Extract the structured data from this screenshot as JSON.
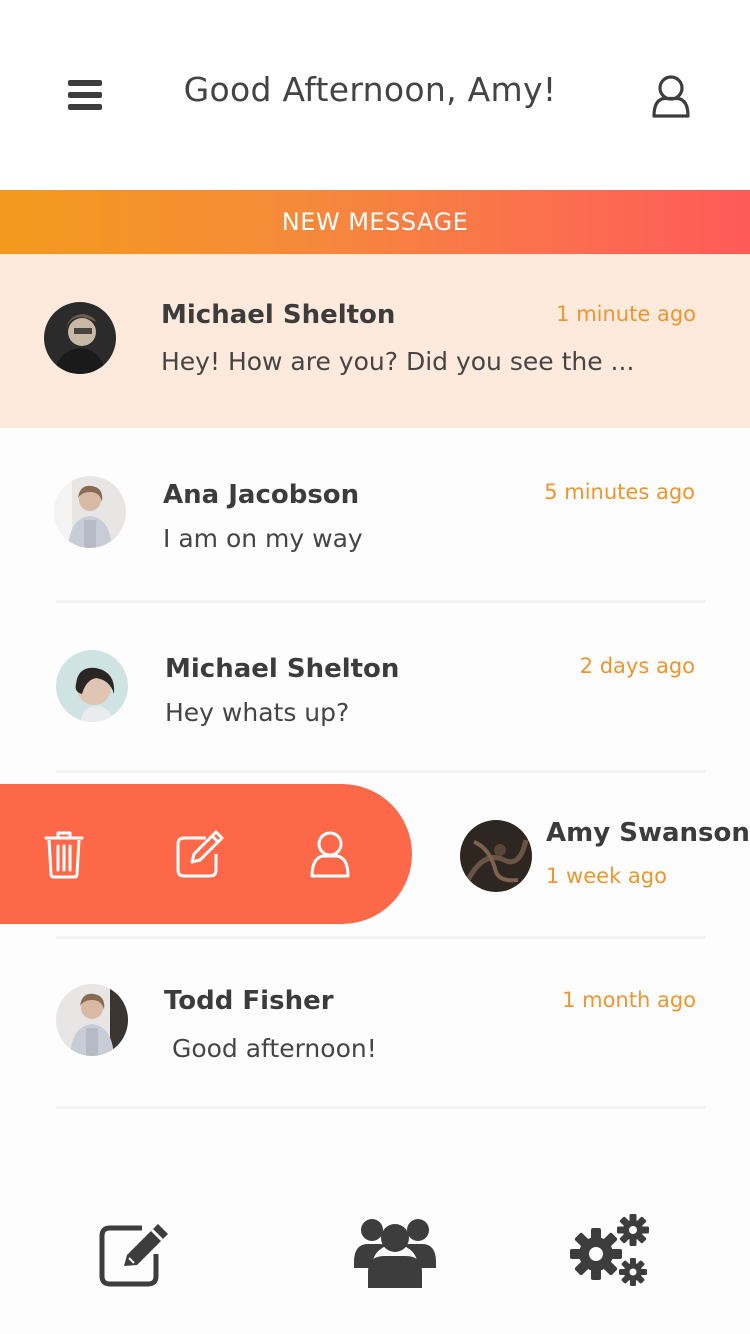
{
  "header": {
    "greeting": "Good Afternoon, Amy!",
    "menu_icon": "hamburger-menu-icon",
    "profile_icon": "user-icon"
  },
  "new_message": {
    "label": "NEW MESSAGE"
  },
  "conversations": [
    {
      "name": "Michael Shelton",
      "time": "1 minute ago",
      "message": "Hey! How are you? Did you see the ...",
      "highlighted": true
    },
    {
      "name": "Ana Jacobson",
      "time": "5 minutes ago",
      "message": "I am on my way"
    },
    {
      "name": "Michael Shelton",
      "time": "2 days ago",
      "message": "Hey whats up?"
    },
    {
      "name": "Amy Swanson",
      "time": "1 week ago",
      "message": ""
    },
    {
      "name": "Todd Fisher",
      "time": "1 month ago",
      "message": " Good afternoon!"
    }
  ],
  "swipe_actions": [
    {
      "icon": "trash-icon"
    },
    {
      "icon": "edit-icon"
    },
    {
      "icon": "user-icon"
    }
  ],
  "bottom_nav": [
    {
      "icon": "compose-icon"
    },
    {
      "icon": "contacts-group-icon"
    },
    {
      "icon": "settings-gears-icon"
    }
  ],
  "colors": {
    "accent_orange": "#ef9530",
    "swipe_red": "#fd6848",
    "highlight_bg": "#fdeadc",
    "gradient_start": "#f39a1d",
    "gradient_end": "#fe5a56",
    "icon_dark": "#3d3d3d"
  }
}
